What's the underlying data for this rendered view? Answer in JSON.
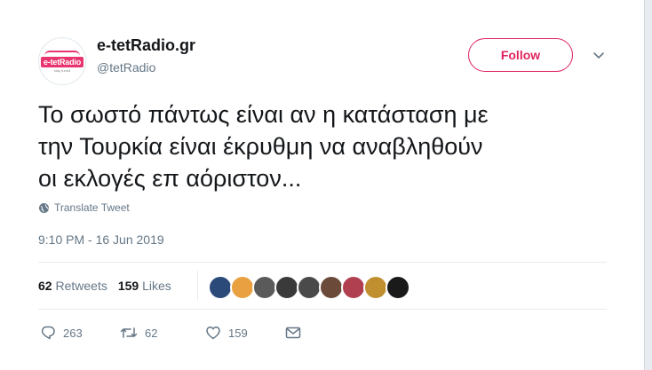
{
  "account": {
    "name": "e-tetRadio.gr",
    "handle": "@tetRadio",
    "logo_text": "e-tetRadio",
    "logo_sub": "stay tuned"
  },
  "follow_label": "Follow",
  "tweet": {
    "text": "Το σωστό πάντως είναι αν η κατάσταση με\nτην Τουρκία είναι έκρυθμη να αναβληθούν\nοι εκλογές επ αόριστον...",
    "translate_label": "Translate Tweet",
    "timestamp": "9:10 PM - 16 Jun 2019"
  },
  "stats": {
    "retweets_count": "62",
    "retweets_label": "Retweets",
    "likes_count": "159",
    "likes_label": "Likes"
  },
  "likers": [
    {
      "color": "#2b4a7a"
    },
    {
      "color": "#e8a040"
    },
    {
      "color": "#5a5a5a"
    },
    {
      "color": "#3a3a3a"
    },
    {
      "color": "#4a4a4a"
    },
    {
      "color": "#6b4a3a"
    },
    {
      "color": "#b04050"
    },
    {
      "color": "#c09030"
    },
    {
      "color": "#1a1a1a"
    }
  ],
  "actions": {
    "replies": "263",
    "retweets": "62",
    "likes": "159"
  },
  "colors": {
    "accent": "#e0245e",
    "brand_logo": "#e8346f",
    "muted": "#657786"
  },
  "icons": [
    "globe-icon",
    "chevron-down-icon",
    "reply-icon",
    "retweet-icon",
    "like-icon",
    "message-icon"
  ]
}
